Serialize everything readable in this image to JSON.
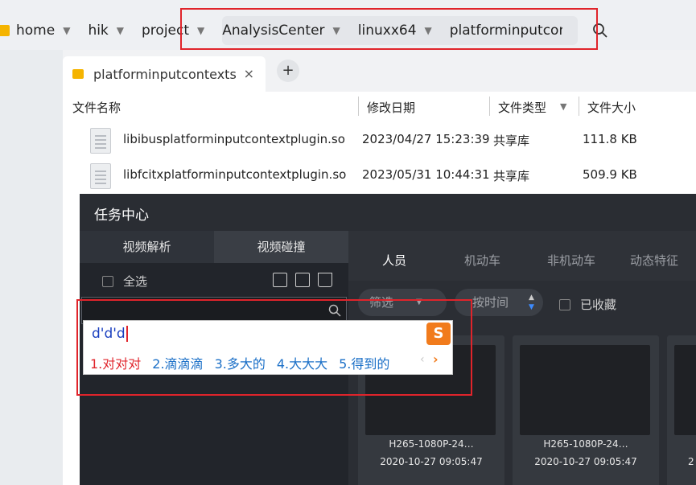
{
  "breadcrumb": {
    "items": [
      "home",
      "hik",
      "project",
      "AnalysisCenter",
      "linuxx64",
      "platforminputcontexts"
    ]
  },
  "tab": {
    "label": "platforminputcontexts",
    "close": "×",
    "add": "+"
  },
  "columns": {
    "name": "文件名称",
    "modified": "修改日期",
    "type": "文件类型",
    "size": "文件大小"
  },
  "files": [
    {
      "name": "libibusplatforminputcontextplugin.so",
      "modified": "2023/04/27 15:23:39",
      "type": "共享库",
      "size": "111.8 KB"
    },
    {
      "name": "libfcitxplatforminputcontextplugin.so",
      "modified": "2023/05/31 10:44:31",
      "type": "共享库",
      "size": "509.9 KB"
    }
  ],
  "task_center": {
    "title": "任务中心",
    "left_tabs": [
      "视频解析",
      "视频碰撞"
    ],
    "select_all": "全选",
    "right_tabs": [
      "人员",
      "机动车",
      "非机动车",
      "动态特征"
    ],
    "filter": "筛选",
    "sort": "按时间",
    "favorited": "已收藏",
    "cards": [
      {
        "name": "H265-1080P-24…",
        "time": "2020-10-27 09:05:47"
      },
      {
        "name": "H265-1080P-24…",
        "time": "2020-10-27 09:05:47"
      },
      {
        "name": "",
        "time": "2"
      }
    ]
  },
  "ime": {
    "input": "d'd'd",
    "logo": "S",
    "candidates": [
      "1.对对对",
      "2.滴滴滴",
      "3.多大的",
      "4.大大大",
      "5.得到的"
    ],
    "prev": "‹",
    "next": "›"
  },
  "colors": {
    "highlight_box": "#e0242b",
    "folder": "#f5b400",
    "ime_candidate": "#1a6fc7",
    "ime_first": "#e0242b",
    "ime_logo": "#f17b1c"
  }
}
